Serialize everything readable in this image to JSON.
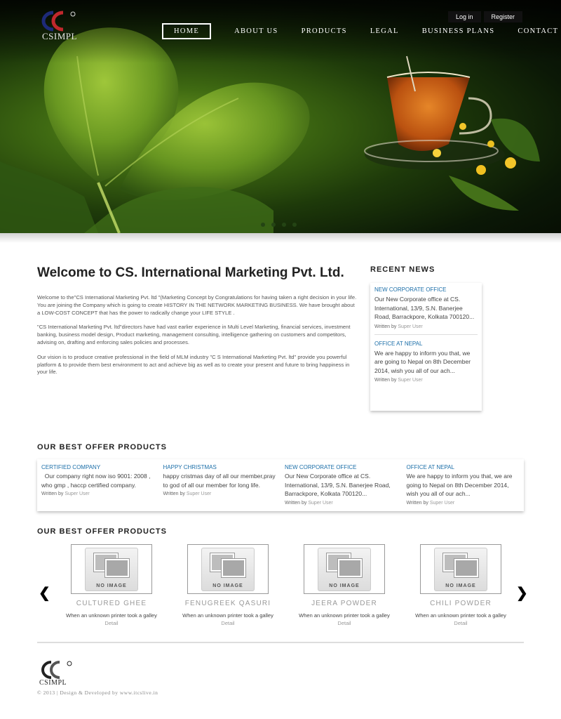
{
  "header": {
    "logo_text": "CSIMPL",
    "top_links": [
      "Log in",
      "Register"
    ],
    "nav": [
      "HOME",
      "ABOUT US",
      "PRODUCTS",
      "LEGAL",
      "BUSINESS PLANS",
      "CONTACT US"
    ],
    "active_nav": "HOME"
  },
  "welcome": {
    "title": "Welcome to CS. International Marketing Pvt. Ltd.",
    "paragraphs": [
      "Welcome to the\"CS International Marketing Pvt. ltd \"(Marketing Concept by Congratulations for having taken a right decision in your life. You are joining the Company which is going to create HISTORY IN THE NETWORK MARKETING BUSINESS. We have brought about a LOW-COST CONCEPT that has the power to radically change your LIFE STYLE .",
      "\"CS International Marketing Pvt. ltd\"directors have had vast earlier experience in Multi Level Marketing, financial services, investment banking, business model design, Product marketing, management consulting, intelligence gathering on customers and competitors, advising on, drafting and enforcing sales policies and processes.",
      "Our vision is to produce creative professional in the field of MLM industry \"C S International Marketing Pvt. ltd\" provide you powerful platform & to provide them best environment to act and achieve big as well as to create your present and future to bring happiness in your life."
    ]
  },
  "recent_news": {
    "title": "RECENT NEWS",
    "items": [
      {
        "head": "NEW CORPORATE OFFICE",
        "text": "Our New Corporate office at CS. International, 13/9, S.N. Banerjee Road, Barrackpore, Kolkata 700120...",
        "by_label": "Written by",
        "author": "Super User"
      },
      {
        "head": "OFFICE AT NEPAL",
        "text": "We are happy to inform you that, we are going to Nepal on 8th December 2014, wish you all of our ach...",
        "by_label": "Written by",
        "author": "Super User"
      }
    ]
  },
  "offers": {
    "title": "OUR BEST OFFER PRODUCTS",
    "items": [
      {
        "head": "CERTIFIED COMPANY",
        "text": "  Our company right now iso 9001: 2008 , who gmp , haccp certified company.",
        "by_label": "Written by",
        "author": "Super User"
      },
      {
        "head": "HAPPY CHRISTMAS",
        "text": "happy cristmas day of all our member,pray to god of all our member for long life.",
        "by_label": "Written by",
        "author": "Super User"
      },
      {
        "head": "NEW CORPORATE OFFICE",
        "text": "Our New Corporate office at CS. International, 13/9, S.N. Banerjee Road, Barrackpore, Kolkata 700120...",
        "by_label": "Written by",
        "author": "Super User"
      },
      {
        "head": "OFFICE AT NEPAL",
        "text": "We are happy to inform you that, we are going to Nepal on 8th December 2014, wish you all of our ach...",
        "by_label": "Written by",
        "author": "Super User"
      }
    ]
  },
  "products": {
    "title": "OUR BEST OFFER PRODUCTS",
    "prev_icon": "❮",
    "next_icon": "❯",
    "items": [
      {
        "placeholder": "NO IMAGE",
        "name": "CULTURED GHEE",
        "desc": "When an unknown printer took a galley",
        "link": "Detail"
      },
      {
        "placeholder": "NO IMAGE",
        "name": "FENUGREEK QASURI",
        "desc": "When an unknown printer took a galley",
        "link": "Detail"
      },
      {
        "placeholder": "NO IMAGE",
        "name": "JEERA POWDER",
        "desc": "When an unknown printer took a galley",
        "link": "Detail"
      },
      {
        "placeholder": "NO IMAGE",
        "name": "CHILI POWDER",
        "desc": "When an unknown printer took a galley",
        "link": "Detail"
      }
    ]
  },
  "footer": {
    "logo_text": "CSIMPL",
    "copyright": "© 2013  |  Design & Developed by www.itcslive.in"
  },
  "colors": {
    "link_blue": "#1b6ea8",
    "logo_red": "#c0282d",
    "logo_navy": "#1d2a78"
  }
}
